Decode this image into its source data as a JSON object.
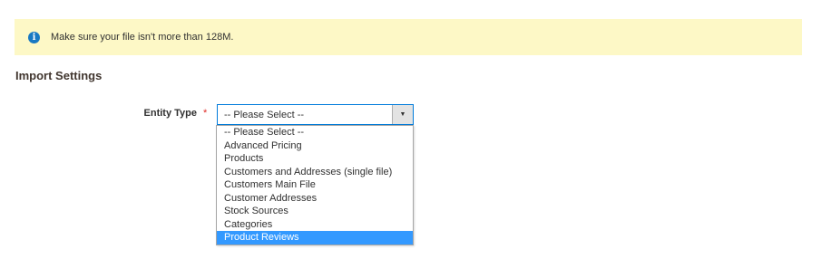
{
  "notice": {
    "icon": "info-icon",
    "text": "Make sure your file isn't more than 128M."
  },
  "section": {
    "title": "Import Settings"
  },
  "entity_type": {
    "label": "Entity Type",
    "required_marker": "*",
    "selected_value": "-- Please Select --",
    "options": [
      "-- Please Select --",
      "Advanced Pricing",
      "Products",
      "Customers and Addresses (single file)",
      "Customers Main File",
      "Customer Addresses",
      "Stock Sources",
      "Categories",
      "Product Reviews"
    ],
    "highlighted_option": "Product Reviews"
  },
  "colors": {
    "notice_bg": "#fdf8c6",
    "info_icon": "#1979c3",
    "select_border": "#007bdb",
    "highlight": "#3399ff",
    "required": "#e02b27"
  }
}
